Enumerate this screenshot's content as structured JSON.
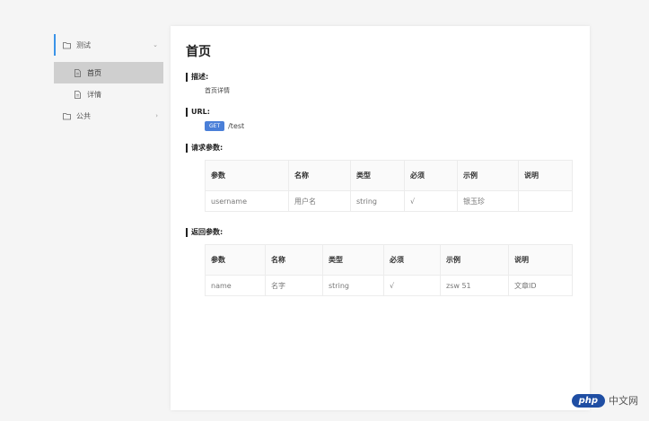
{
  "sidebar": {
    "items": [
      {
        "label": "测试"
      },
      {
        "label": "首页"
      },
      {
        "label": "详情"
      },
      {
        "label": "公共"
      }
    ]
  },
  "main": {
    "title": "首页",
    "desc_title": "描述:",
    "desc_text": "首页详情",
    "url_title": "URL:",
    "method": "GET",
    "path": "/test",
    "req_title": "请求参数:",
    "resp_title": "返回参数:"
  },
  "request_table": {
    "headers": [
      "参数",
      "名称",
      "类型",
      "必须",
      "示例",
      "说明"
    ],
    "rows": [
      [
        "username",
        "用户名",
        "string",
        "√",
        "银玉珍",
        ""
      ]
    ]
  },
  "response_table": {
    "headers": [
      "参数",
      "名称",
      "类型",
      "必须",
      "示例",
      "说明"
    ],
    "rows": [
      [
        "name",
        "名字",
        "string",
        "√",
        "zsw 51",
        "文章ID"
      ]
    ]
  },
  "watermark": {
    "logo": "php",
    "text": "中文网"
  },
  "colors": {
    "accent": "#3a93e8",
    "method_bg": "#4a7fd8",
    "active_bg": "#cfcfcf"
  }
}
